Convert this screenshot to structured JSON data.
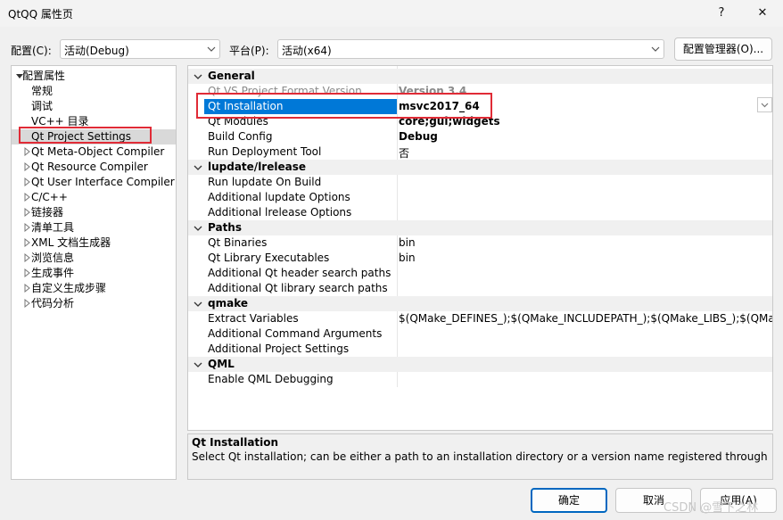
{
  "window": {
    "title": "QtQQ 属性页",
    "help_label": "?",
    "close_label": "✕"
  },
  "config_bar": {
    "config_label": "配置(C):",
    "config_value": "活动(Debug)",
    "platform_label": "平台(P):",
    "platform_value": "活动(x64)",
    "manager_label": "配置管理器(O)..."
  },
  "tree": {
    "root": "配置属性",
    "items": [
      "常规",
      "调试",
      "VC++ 目录",
      "Qt Project Settings",
      "Qt Meta-Object Compiler",
      "Qt Resource Compiler",
      "Qt User Interface Compiler",
      "C/C++",
      "链接器",
      "清单工具",
      "XML 文档生成器",
      "浏览信息",
      "生成事件",
      "自定义生成步骤",
      "代码分析"
    ]
  },
  "grid": {
    "categories": [
      {
        "name": "General",
        "props": [
          {
            "name": "Qt VS Project Format Version",
            "value": "Version 3.4"
          },
          {
            "name": "Qt Installation",
            "value": "msvc2017_64"
          },
          {
            "name": "Qt Modules",
            "value": "core;gui;widgets"
          },
          {
            "name": "Build Config",
            "value": "Debug"
          },
          {
            "name": "Run Deployment Tool",
            "value": "否"
          }
        ]
      },
      {
        "name": "lupdate/lrelease",
        "props": [
          {
            "name": "Run lupdate On Build",
            "value": ""
          },
          {
            "name": "Additional lupdate Options",
            "value": ""
          },
          {
            "name": "Additional lrelease Options",
            "value": ""
          }
        ]
      },
      {
        "name": "Paths",
        "props": [
          {
            "name": "Qt Binaries",
            "value": "bin"
          },
          {
            "name": "Qt Library Executables",
            "value": "bin"
          },
          {
            "name": "Additional Qt header search paths",
            "value": ""
          },
          {
            "name": "Additional Qt library search paths",
            "value": ""
          }
        ]
      },
      {
        "name": "qmake",
        "props": [
          {
            "name": "Extract Variables",
            "value": "$(QMake_DEFINES_);$(QMake_INCLUDEPATH_);$(QMake_LIBS_);$(QMake"
          },
          {
            "name": "Additional Command Arguments",
            "value": ""
          },
          {
            "name": "Additional Project Settings",
            "value": ""
          }
        ]
      },
      {
        "name": "QML",
        "props": [
          {
            "name": "Enable QML Debugging",
            "value": ""
          }
        ]
      }
    ]
  },
  "description": {
    "title": "Qt Installation",
    "text": "Select Qt installation; can be either a path to an installation directory or a version name registered through the ..."
  },
  "buttons": {
    "ok": "确定",
    "cancel": "取消",
    "apply": "应用(A)"
  },
  "watermark": "CSDN @雪下之林"
}
